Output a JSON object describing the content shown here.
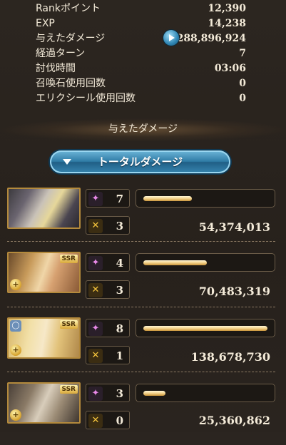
{
  "stats": [
    {
      "label": "Rankポイント",
      "value": "12,390"
    },
    {
      "label": "EXP",
      "value": "14,238"
    },
    {
      "label": "与えたダメージ",
      "value": "288,896,924"
    },
    {
      "label": "経過ターン",
      "value": "7"
    },
    {
      "label": "討伐時間",
      "value": "03:06"
    },
    {
      "label": "召喚石使用回数",
      "value": "0"
    },
    {
      "label": "エリクシール使用回数",
      "value": "0"
    }
  ],
  "damage_section": {
    "title": "与えたダメージ",
    "dropdown_label": "トータルダメージ"
  },
  "characters": [
    {
      "portrait": "character-portrait-1",
      "sparkle_count": "7",
      "chain_count": "3",
      "damage": "54,374,013",
      "bar_fraction": 0.39,
      "ssr": false,
      "skill_badge": false,
      "ring_badge": false
    },
    {
      "portrait": "character-portrait-2",
      "sparkle_count": "4",
      "chain_count": "3",
      "damage": "70,483,319",
      "bar_fraction": 0.51,
      "ssr": true,
      "ssr_label": "SSR",
      "skill_badge": true,
      "ring_badge": false
    },
    {
      "portrait": "character-portrait-3",
      "sparkle_count": "8",
      "chain_count": "1",
      "damage": "138,678,730",
      "bar_fraction": 1.0,
      "ssr": true,
      "ssr_label": "SSR",
      "skill_badge": true,
      "ring_badge": true
    },
    {
      "portrait": "character-portrait-4",
      "sparkle_count": "3",
      "chain_count": "0",
      "damage": "25,360,862",
      "bar_fraction": 0.18,
      "ssr": true,
      "ssr_label": "SSR",
      "skill_badge": true,
      "ring_badge": false
    }
  ],
  "colors": {
    "background": "#2b2520",
    "text": "#f3ead8",
    "button_blue": "#2f7ca6",
    "bar_gold": "#f3d28a",
    "border_gold": "#b48a3c"
  }
}
